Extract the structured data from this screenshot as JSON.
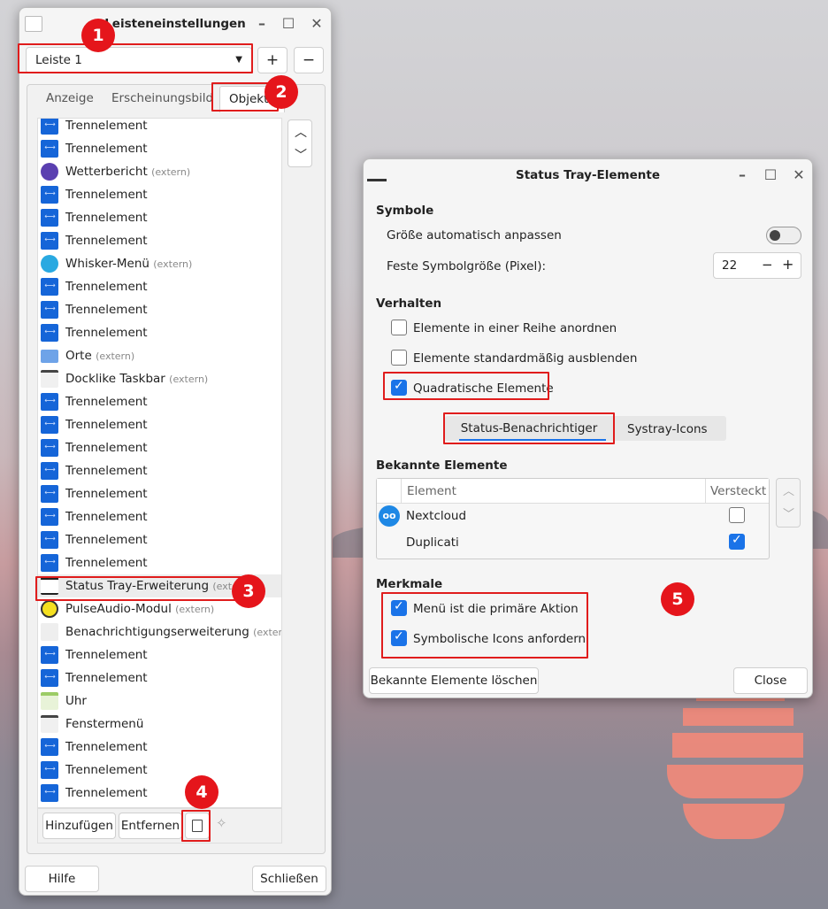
{
  "panel_window": {
    "title": "Leisteneinstellungen",
    "panel_select": "Leiste 1",
    "add_panel": "+",
    "remove_panel": "−",
    "tabs": [
      "Anzeige",
      "Erscheinungsbild",
      "Objekte"
    ],
    "items": [
      {
        "label": "Trennelement",
        "ext": "",
        "icon": "separator"
      },
      {
        "label": "Trennelement",
        "ext": "",
        "icon": "separator"
      },
      {
        "label": "Wetterbericht",
        "ext": "(extern)",
        "icon": "weather"
      },
      {
        "label": "Trennelement",
        "ext": "",
        "icon": "separator"
      },
      {
        "label": "Trennelement",
        "ext": "",
        "icon": "separator"
      },
      {
        "label": "Trennelement",
        "ext": "",
        "icon": "separator"
      },
      {
        "label": "Whisker-Menü",
        "ext": "(extern)",
        "icon": "whisker"
      },
      {
        "label": "Trennelement",
        "ext": "",
        "icon": "separator"
      },
      {
        "label": "Trennelement",
        "ext": "",
        "icon": "separator"
      },
      {
        "label": "Trennelement",
        "ext": "",
        "icon": "separator"
      },
      {
        "label": "Orte",
        "ext": "(extern)",
        "icon": "folder"
      },
      {
        "label": "Docklike Taskbar",
        "ext": "(extern)",
        "icon": "gear"
      },
      {
        "label": "Trennelement",
        "ext": "",
        "icon": "separator"
      },
      {
        "label": "Trennelement",
        "ext": "",
        "icon": "separator"
      },
      {
        "label": "Trennelement",
        "ext": "",
        "icon": "separator"
      },
      {
        "label": "Trennelement",
        "ext": "",
        "icon": "separator"
      },
      {
        "label": "Trennelement",
        "ext": "",
        "icon": "separator"
      },
      {
        "label": "Trennelement",
        "ext": "",
        "icon": "separator"
      },
      {
        "label": "Trennelement",
        "ext": "",
        "icon": "separator"
      },
      {
        "label": "Trennelement",
        "ext": "",
        "icon": "separator"
      },
      {
        "label": "Status Tray-Erweiterung",
        "ext": "(extern)",
        "icon": "tray"
      },
      {
        "label": "PulseAudio-Modul",
        "ext": "(extern)",
        "icon": "audio"
      },
      {
        "label": "Benachrichtigungserweiterung",
        "ext": "(extern)",
        "icon": "notify"
      },
      {
        "label": "Trennelement",
        "ext": "",
        "icon": "separator"
      },
      {
        "label": "Trennelement",
        "ext": "",
        "icon": "separator"
      },
      {
        "label": "Uhr",
        "ext": "",
        "icon": "clock"
      },
      {
        "label": "Fenstermenü",
        "ext": "",
        "icon": "gear"
      },
      {
        "label": "Trennelement",
        "ext": "",
        "icon": "separator"
      },
      {
        "label": "Trennelement",
        "ext": "",
        "icon": "separator"
      },
      {
        "label": "Trennelement",
        "ext": "",
        "icon": "separator"
      }
    ],
    "add_button": "Hinzufügen",
    "remove_button": "Entfernen",
    "help_button": "Hilfe",
    "close_button": "Schließen"
  },
  "tray_dialog": {
    "title": "Status Tray-Elemente",
    "section_symbols": "Symbole",
    "auto_size_label": "Größe automatisch anpassen",
    "fixed_size_label": "Feste Symbolgröße (Pixel):",
    "fixed_size_value": "22",
    "section_behavior": "Verhalten",
    "row_label": "Elemente in einer Reihe anordnen",
    "hide_label": "Elemente standardmäßig ausblenden",
    "square_label": "Quadratische Elemente",
    "tab_status": "Status-Benachrichtiger",
    "tab_systray": "Systray-Icons",
    "section_known": "Bekannte Elemente",
    "col_element": "Element",
    "col_hidden": "Versteckt",
    "known_items": [
      {
        "name": "Nextcloud",
        "hidden": false
      },
      {
        "name": "Duplicati",
        "hidden": true
      }
    ],
    "section_features": "Merkmale",
    "menu_primary_label": "Menü ist die primäre Aktion",
    "symbolic_label": "Symbolische Icons anfordern",
    "clear_button": "Bekannte Elemente löschen",
    "close_button": "Close"
  },
  "badges": [
    "1",
    "2",
    "3",
    "4",
    "5"
  ],
  "colors": {
    "accent": "#1a73e8",
    "highlight_red": "#e01c1c",
    "separator_icon": "#1565d8"
  }
}
